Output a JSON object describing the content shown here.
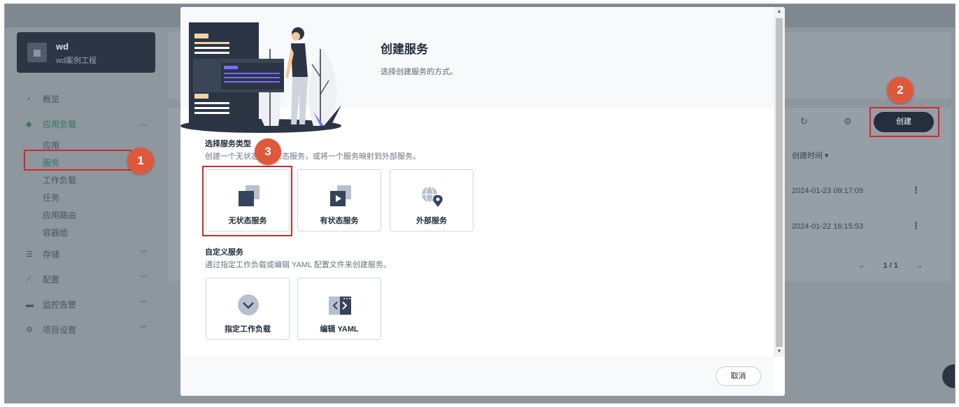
{
  "project": {
    "name": "wd",
    "description": "wd案例工程"
  },
  "nav": {
    "overview": "概览",
    "workloads": "应用负载",
    "sub_items": [
      "应用",
      "服务",
      "工作负载",
      "任务",
      "应用路由",
      "容器组"
    ],
    "storage": "存储",
    "config": "配置",
    "monitoring": "监控告警",
    "project_settings": "项目设置"
  },
  "list": {
    "create_label": "创建",
    "column_created": "创建时间 ▾",
    "rows": [
      {
        "created": "2024-01-23 09:17:09"
      },
      {
        "created": "2024-01-22 16:15:53"
      }
    ],
    "pager": "1 / 1"
  },
  "markers": [
    "1",
    "2",
    "3"
  ],
  "modal": {
    "title": "创建服务",
    "subtitle": "选择创建服务的方式。",
    "section1_title": "选择服务类型",
    "section1_desc": "创建一个无状态或有状态服务，或将一个服务映射到外部服务。",
    "service_types": [
      "无状态服务",
      "有状态服务",
      "外部服务"
    ],
    "section2_title": "自定义服务",
    "section2_desc": "通过指定工作负载或编辑 YAML 配置文件来创建服务。",
    "custom_types": [
      "指定工作负载",
      "编辑 YAML"
    ],
    "cancel_label": "取消"
  },
  "colors": {
    "highlight": "#d7262b",
    "marker": "#e0583c",
    "primary_dark": "#242e3c",
    "accent_green": "#2f7a5b"
  }
}
